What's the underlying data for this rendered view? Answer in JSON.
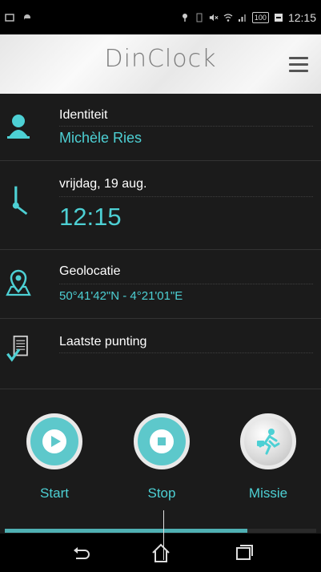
{
  "status_bar": {
    "time": "12:15",
    "battery": "100"
  },
  "header": {
    "title": "DinClock"
  },
  "rows": [
    {
      "label": "Identiteit",
      "value": "Michèle Ries"
    },
    {
      "label": "vrijdag, 19 aug.",
      "value": "12:15"
    },
    {
      "label": "Geolocatie",
      "value": "50°41'42\"N - 4°21'01\"E"
    },
    {
      "label": "Laatste punting",
      "value": ""
    }
  ],
  "buttons": {
    "start": "Start",
    "stop": "Stop",
    "missie": "Missie"
  },
  "progress": {
    "fraction": 0.78
  },
  "colors": {
    "accent": "#4dd0d4",
    "button": "#5dc8cb",
    "background": "#1b1b1b"
  }
}
